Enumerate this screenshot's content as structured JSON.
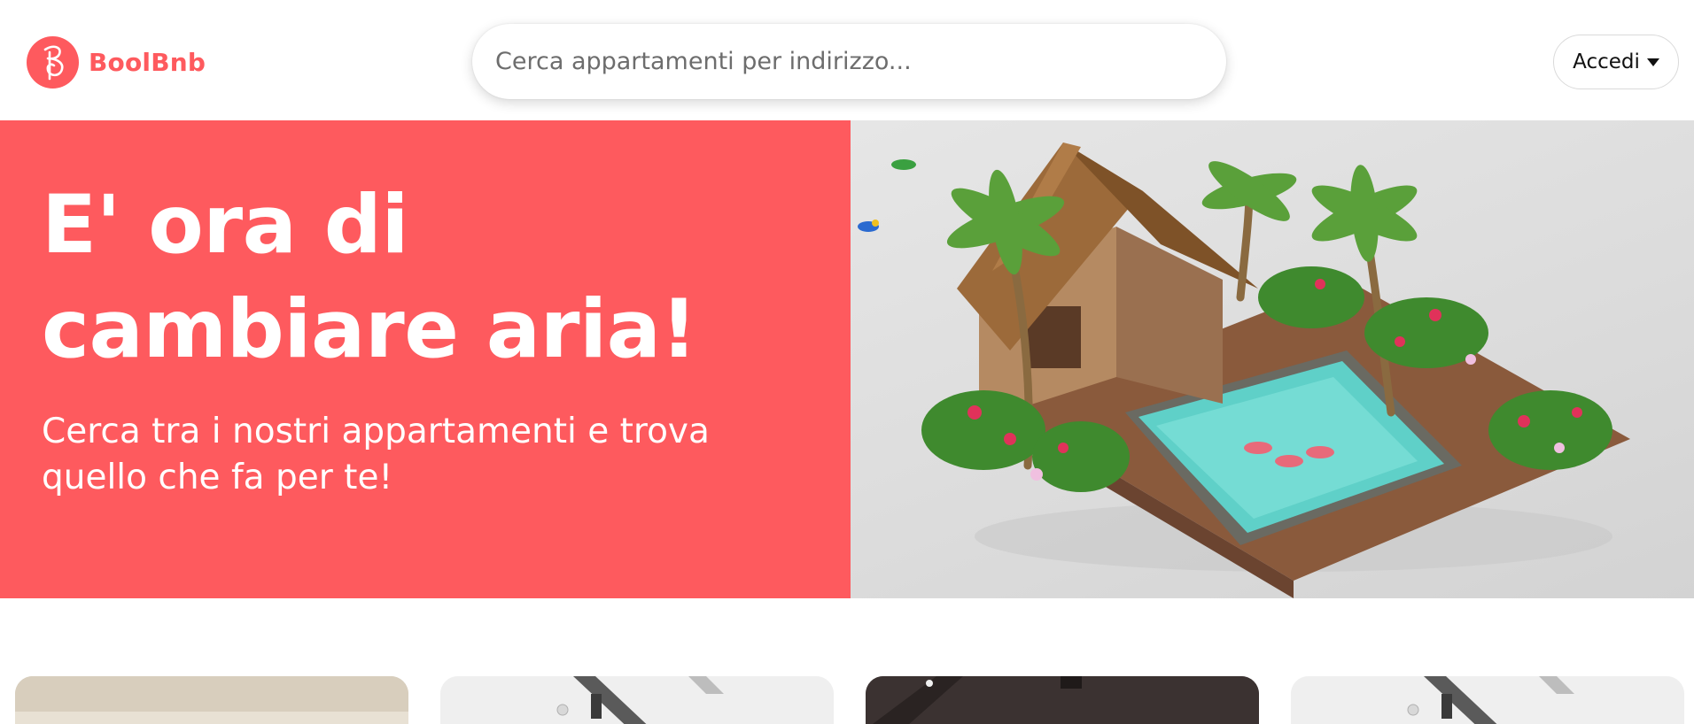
{
  "brand": {
    "name": "BoolBnb",
    "logo_icon": "boolbnb-logo-icon",
    "accent_color": "#fe5a5e"
  },
  "search": {
    "placeholder": "Cerca appartamenti per indirizzo...",
    "value": ""
  },
  "auth": {
    "login_label": "Accedi",
    "dropdown_icon": "caret-down-icon"
  },
  "hero": {
    "title": "E' ora di cambiare aria!",
    "subtitle": "Cerca tra i nostri appartamenti e trova quello che fa per te!",
    "image": "tropical-house-pool-illustration"
  },
  "apartments": {
    "cards": [
      {
        "image": "apartment-photo"
      },
      {
        "image": "apartment-photo"
      },
      {
        "image": "apartment-photo"
      },
      {
        "image": "apartment-photo"
      }
    ]
  }
}
